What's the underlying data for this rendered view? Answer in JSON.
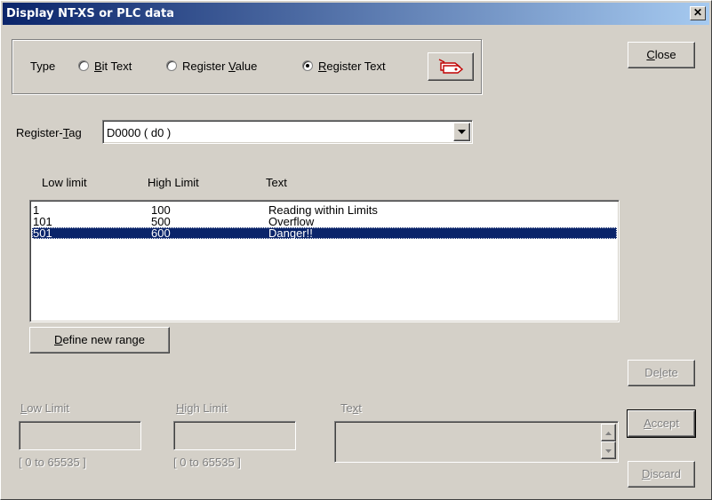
{
  "window": {
    "title": "Display NT-XS or PLC data",
    "close_glyph": "✕"
  },
  "type_group": {
    "label": "Type",
    "options": [
      {
        "label": "Bit Text",
        "mnemonic": "B",
        "rest": "it Text",
        "selected": false
      },
      {
        "label": "Register Value",
        "pre": "Register ",
        "mnemonic": "V",
        "rest": "alue",
        "selected": false
      },
      {
        "label": "Register Text",
        "mnemonic": "R",
        "rest": "egister Text",
        "selected": true
      }
    ],
    "tag_icon": "tag-icon"
  },
  "register_tag": {
    "label_pre": "Register-",
    "label_mn": "T",
    "label_post": "ag",
    "value": "D0000 ( d0 )"
  },
  "table": {
    "columns": [
      "Low limit",
      "High Limit",
      "Text"
    ],
    "rows": [
      {
        "low": "1",
        "high": "100",
        "text": "Reading within Limits",
        "selected": false
      },
      {
        "low": "101",
        "high": "500",
        "text": "Overflow",
        "selected": false
      },
      {
        "low": "501",
        "high": "600",
        "text": "Danger!!",
        "selected": true
      }
    ]
  },
  "buttons": {
    "close": {
      "mn": "C",
      "rest": "lose"
    },
    "define": {
      "mn": "D",
      "rest": "efine new range"
    },
    "delete": {
      "pre": "De",
      "mn": "l",
      "rest": "ete"
    },
    "accept": {
      "mn": "A",
      "rest": "ccept"
    },
    "discard": {
      "mn": "D",
      "rest": "iscard"
    }
  },
  "edit": {
    "low": {
      "pre": "",
      "mn": "L",
      "rest": "ow Limit",
      "range": "[ 0 to 65535 ]",
      "value": ""
    },
    "high": {
      "pre": "",
      "mn": "H",
      "rest": "igh Limit",
      "range": "[ 0 to 65535 ]",
      "value": ""
    },
    "text": {
      "pre": "Te",
      "mn": "x",
      "rest": "t",
      "value": ""
    }
  },
  "colors": {
    "titlebar_start": "#0a246a",
    "titlebar_end": "#a6caf0",
    "face": "#d4d0c8",
    "selection": "#0a246a"
  }
}
